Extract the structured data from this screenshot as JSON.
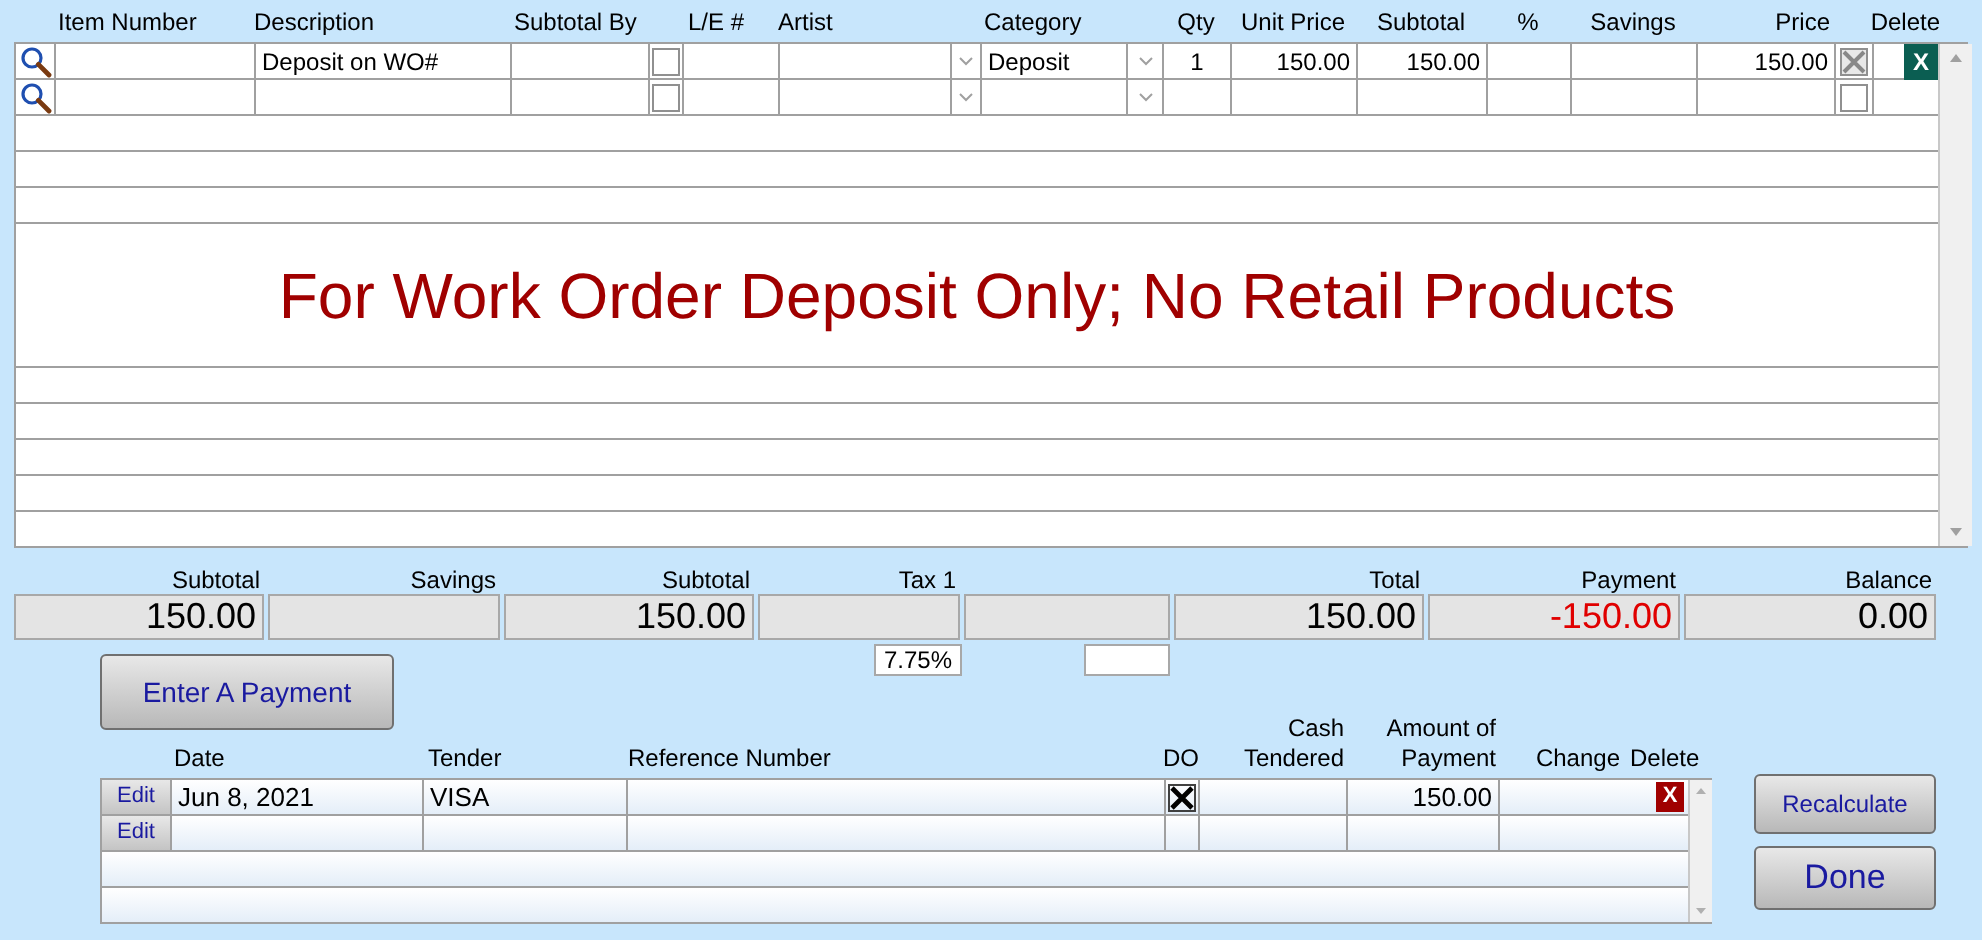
{
  "line_items": {
    "columns": [
      "Item Number",
      "Description",
      "Subtotal By",
      "L/E #",
      "Artist",
      "Category",
      "Qty",
      "Unit Price",
      "Subtotal",
      "%",
      "Savings",
      "Price",
      "Delete"
    ],
    "rows": [
      {
        "description": "Deposit on WO#",
        "marked": false,
        "category": "Deposit",
        "qty": "1",
        "unit_price": "150.00",
        "subtotal": "150.00",
        "price": "150.00",
        "included": true,
        "delete": "X"
      },
      {
        "marked": false,
        "included": false
      }
    ]
  },
  "notice": "For Work Order Deposit Only; No Retail Products",
  "totals": [
    {
      "label": "Subtotal",
      "value": "150.00",
      "color": "#000000"
    },
    {
      "label": "Savings"
    },
    {
      "label": "Subtotal",
      "value": "150.00",
      "color": "#000000"
    },
    {
      "label": "Tax 1"
    },
    {
      "label": "Total",
      "value": "150.00",
      "color": "#000000"
    },
    {
      "label": "Payment",
      "value": "-150.00",
      "color": "#e00000"
    },
    {
      "label": "Balance",
      "value": "0.00",
      "color": "#000000"
    }
  ],
  "tax_rate": "7.75%",
  "enter_payment_button": "Enter A Payment",
  "payments": {
    "columns": [
      "Date",
      "Tender",
      "Reference Number",
      "DO",
      "Cash Tendered",
      "Amount of Payment",
      "Change",
      "Delete"
    ],
    "rows": [
      {
        "edit": "Edit",
        "date": "Jun 8, 2021",
        "tender": "VISA",
        "do": true,
        "amount": "150.00",
        "delete": "X"
      },
      {
        "edit": "Edit",
        "do": false
      }
    ]
  },
  "buttons": [
    {
      "label": "Recalculate",
      "kind": "secondary"
    },
    {
      "label": "Done",
      "kind": "primary"
    }
  ]
}
